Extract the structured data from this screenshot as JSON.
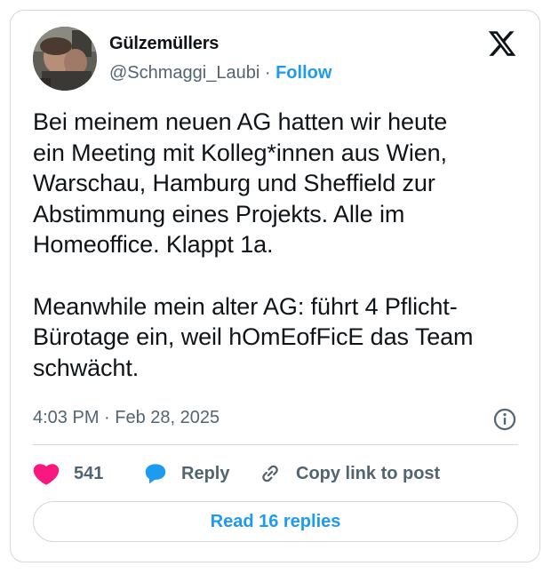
{
  "author": {
    "display_name": "Gülzemüllers",
    "handle": "@Schmaggi_Laubi",
    "separator": "·",
    "follow_label": "Follow"
  },
  "post": {
    "text": "Bei meinem neuen AG hatten wir heute\nein Meeting mit Kolleg*innen aus Wien,\nWarschau, Hamburg und Sheffield zur\nAbstimmung eines Projekts. Alle im\nHomeoffice. Klappt 1a.\n\nMeanwhile mein alter AG: führt 4 Pflicht-\nBürotage ein, weil hOmEofFicE das Team\nschwächt.",
    "time": "4:03 PM",
    "separator": "·",
    "date": "Feb 28, 2025"
  },
  "actions": {
    "like_count": "541",
    "reply_label": "Reply",
    "copy_link_label": "Copy link to post"
  },
  "footer": {
    "read_replies_label": "Read 16 replies"
  },
  "colors": {
    "accent": "#1d9bf0",
    "like": "#f91880",
    "text": "#0f1419",
    "muted": "#536471",
    "border": "#cfd9de"
  },
  "icons": [
    "x-logo-icon",
    "info-icon",
    "heart-icon",
    "reply-bubble-icon",
    "link-icon"
  ]
}
